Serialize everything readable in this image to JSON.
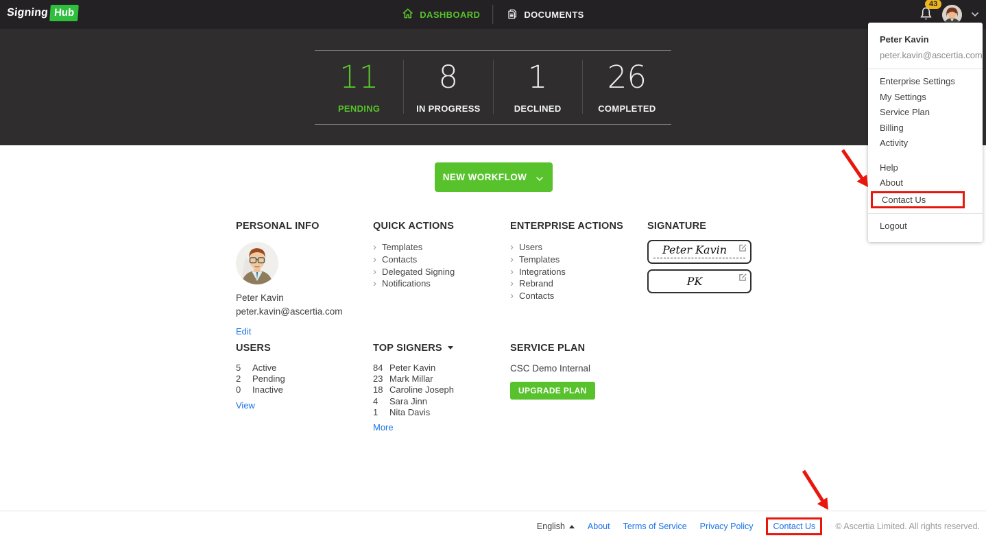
{
  "header": {
    "logo_text": "Signing",
    "logo_hub": "Hub",
    "nav": [
      {
        "label": "DASHBOARD"
      },
      {
        "label": "DOCUMENTS"
      }
    ],
    "notification_count": "43"
  },
  "stats": [
    {
      "value": "11",
      "label": "PENDING"
    },
    {
      "value": "8",
      "label": "IN PROGRESS"
    },
    {
      "value": "1",
      "label": "DECLINED"
    },
    {
      "value": "26",
      "label": "COMPLETED"
    }
  ],
  "workflow_button": {
    "label": "NEW WORKFLOW"
  },
  "personal_info": {
    "title": "PERSONAL INFO",
    "name": "Peter Kavin",
    "email": "peter.kavin@ascertia.com",
    "edit_label": "Edit"
  },
  "quick_actions": {
    "title": "QUICK ACTIONS",
    "items": [
      "Templates",
      "Contacts",
      "Delegated Signing",
      "Notifications"
    ]
  },
  "enterprise_actions": {
    "title": "ENTERPRISE ACTIONS",
    "items": [
      "Users",
      "Templates",
      "Integrations",
      "Rebrand",
      "Contacts"
    ]
  },
  "signature": {
    "title": "SIGNATURE",
    "full_signature": "Peter Kavin",
    "initials": "PK"
  },
  "users": {
    "title": "USERS",
    "rows": [
      {
        "count": "5",
        "label": "Active"
      },
      {
        "count": "2",
        "label": "Pending"
      },
      {
        "count": "0",
        "label": "Inactive"
      }
    ],
    "view_label": "View"
  },
  "top_signers": {
    "title": "TOP SIGNERS",
    "rows": [
      {
        "count": "84",
        "name": "Peter Kavin"
      },
      {
        "count": "23",
        "name": "Mark Millar"
      },
      {
        "count": "18",
        "name": "Caroline Joseph"
      },
      {
        "count": "4",
        "name": "Sara Jinn"
      },
      {
        "count": "1",
        "name": "Nita Davis"
      }
    ],
    "more_label": "More"
  },
  "service_plan": {
    "title": "SERVICE PLAN",
    "plan_name": "CSC Demo Internal",
    "upgrade_label": "UPGRADE PLAN"
  },
  "user_menu": {
    "name": "Peter Kavin",
    "email": "peter.kavin@ascertia.com",
    "items_account": [
      "Enterprise Settings",
      "My Settings",
      "Service Plan",
      "Billing",
      "Activity"
    ],
    "items_support": [
      "Help",
      "About",
      "Contact Us"
    ],
    "logout_label": "Logout",
    "highlighted_item": "Contact Us"
  },
  "footer": {
    "language": "English",
    "links": [
      "About",
      "Terms of Service",
      "Privacy Policy",
      "Contact Us"
    ],
    "highlighted_link": "Contact Us",
    "copyright": "© Ascertia Limited. All rights reserved."
  },
  "colors": {
    "accent_green": "#57c22b",
    "dark_header": "#242124",
    "dark_band": "#2f2d2e",
    "link_blue": "#1a73e8",
    "annotation_red": "#e8160c",
    "badge_yellow": "#efb51e"
  }
}
